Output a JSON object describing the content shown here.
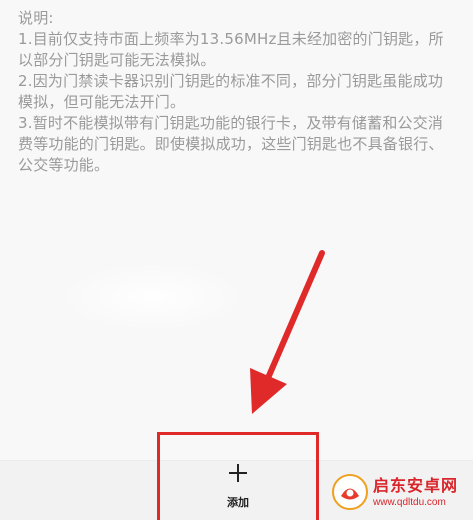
{
  "notes": {
    "title": "说明:",
    "items": [
      "1.目前仅支持市面上频率为13.56MHz且未经加密的门钥匙，所以部分门钥匙可能无法模拟。",
      "2.因为门禁读卡器识别门钥匙的标准不同，部分门钥匙虽能成功模拟，但可能无法开门。",
      "3.暂时不能模拟带有门钥匙功能的银行卡，及带有储蓄和公交消费等功能的门钥匙。即使模拟成功，这些门钥匙也不具备银行、公交等功能。"
    ]
  },
  "bottom_bar": {
    "add_label": "添加",
    "add_icon": "plus-icon"
  },
  "annotation": {
    "color": "#e02a2a",
    "arrow_icon": "arrow-icon"
  },
  "watermark": {
    "name": "启东安卓网",
    "url": "www.qdltdu.com",
    "color": "#d9252a"
  }
}
